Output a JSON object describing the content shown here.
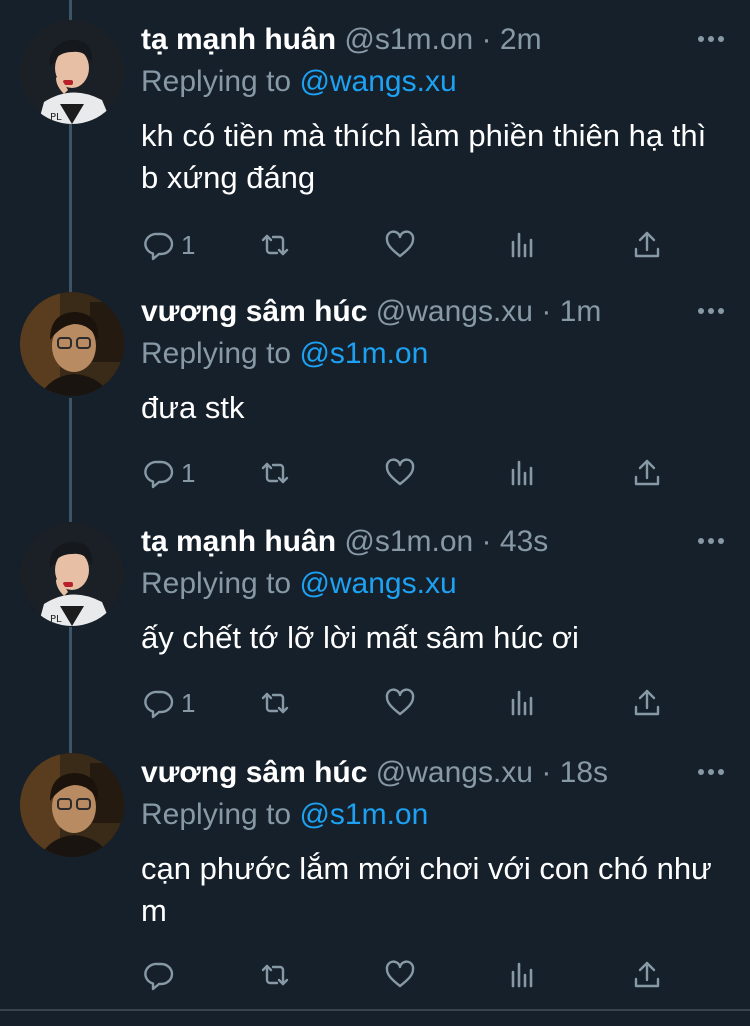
{
  "tweets": [
    {
      "name": "tạ mạnh huân",
      "handle": "@s1m.on",
      "sep": "·",
      "time": "2m",
      "replying_prefix": "Replying to",
      "replying_to": "@wangs.xu",
      "text": "kh có tiền mà thích làm phiền thiên hạ thì b xứng đáng",
      "reply_count": "1",
      "avatar": "avatar-huan"
    },
    {
      "name": "vương sâm húc",
      "handle": "@wangs.xu",
      "sep": "·",
      "time": "1m",
      "replying_prefix": "Replying to",
      "replying_to": "@s1m.on",
      "text": "đưa stk",
      "reply_count": "1",
      "avatar": "avatar-huc"
    },
    {
      "name": "tạ mạnh huân",
      "handle": "@s1m.on",
      "sep": "·",
      "time": "43s",
      "replying_prefix": "Replying to",
      "replying_to": "@wangs.xu",
      "text": "ấy chết tớ lỡ lời mất sâm húc ơi",
      "reply_count": "1",
      "avatar": "avatar-huan"
    },
    {
      "name": "vương sâm húc",
      "handle": "@wangs.xu",
      "sep": "·",
      "time": "18s",
      "replying_prefix": "Replying to",
      "replying_to": "@s1m.on",
      "text": "cạn phước lắm mới chơi với con chó như m",
      "reply_count": "",
      "avatar": "avatar-huc"
    }
  ],
  "icons": [
    "reply-icon",
    "retweet-icon",
    "like-icon",
    "analytics-icon",
    "share-icon",
    "more-icon"
  ],
  "colors": {
    "background": "#15202b",
    "secondary_text": "#8899a6",
    "mention": "#1da1f2",
    "thread_line": "#3d5466",
    "divider": "#38444d"
  }
}
